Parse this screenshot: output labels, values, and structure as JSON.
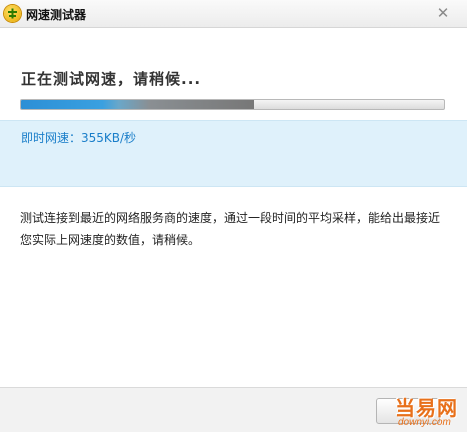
{
  "window": {
    "title": "网速测试器",
    "close_glyph": "✕"
  },
  "status": {
    "heading": "正在测试网速，请稍候...",
    "progress_percent": 55
  },
  "speed": {
    "text": "即时网速：355KB/秒"
  },
  "description": {
    "text": "测试连接到最近的网络服务商的速度，通过一段时间的平均采样，能给出最接近您实际上网速度的数值，请稍候。"
  },
  "watermark": {
    "brand": "当易网",
    "domain": "downyi.com"
  },
  "colors": {
    "accent": "#1a7ec9",
    "panel": "#dff1fb",
    "watermark": "#e8701a"
  }
}
